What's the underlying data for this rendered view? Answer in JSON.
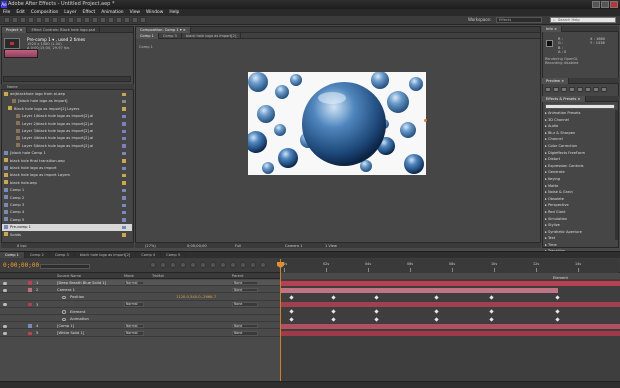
{
  "window": {
    "title": "Adobe After Effects - Untitled Project.aep *",
    "app_icon": "Ae"
  },
  "menu": [
    "File",
    "Edit",
    "Composition",
    "Layer",
    "Effect",
    "Animation",
    "View",
    "Window",
    "Help"
  ],
  "toolbar": {
    "workspace_label": "Workspace:",
    "workspace_value": "Effects",
    "search_placeholder": "Search Help"
  },
  "project": {
    "tabs": [
      "Project ×",
      "Effect Controls: Black hole logo.psd"
    ],
    "selected_comp": "Pre-comp 1 ▾ , used 2 times",
    "comp_info": "1920 x 1080 (1.00)\nΔ 0;00;15;00, 29.97 fps",
    "column_header": "Name",
    "items": [
      {
        "label": "ae(blackhole logo from ai.aep",
        "type": "folder",
        "indent": 0,
        "color": "#c9a94a"
      },
      {
        "label": "[black hole logo as import]",
        "type": "layer",
        "indent": 2,
        "color": "#888888"
      },
      {
        "label": "Black hole logo as import[2] Layers",
        "type": "folder",
        "indent": 1,
        "color": "#c9a94a"
      },
      {
        "label": "Layer 1/black hole logo as import[2].ai",
        "type": "layer",
        "indent": 3,
        "color": "#7f7fbf"
      },
      {
        "label": "Layer 2/black hole logo as import[2].ai",
        "type": "layer",
        "indent": 3,
        "color": "#7f7fbf"
      },
      {
        "label": "Layer 3/black hole logo as import[2].ai",
        "type": "layer",
        "indent": 3,
        "color": "#7f7fbf"
      },
      {
        "label": "Layer 4/black hole logo as import[2].ai",
        "type": "layer",
        "indent": 3,
        "color": "#7f7fbf"
      },
      {
        "label": "Layer 5/black hole logo as import[2].ai",
        "type": "layer",
        "indent": 3,
        "color": "#7f7fbf"
      },
      {
        "label": "[black hole Comp 1",
        "type": "comp",
        "indent": 0,
        "color": "#7a8ab5"
      },
      {
        "label": "black hole final transition.aep",
        "type": "folder",
        "indent": 0,
        "color": "#c9a94a"
      },
      {
        "label": "black hole logo as import",
        "type": "comp",
        "indent": 0,
        "color": "#7a8ab5"
      },
      {
        "label": "black hole logo as import Layers",
        "type": "folder",
        "indent": 0,
        "color": "#c9a94a"
      },
      {
        "label": "black hole.aep",
        "type": "folder",
        "indent": 0,
        "color": "#c9a94a"
      },
      {
        "label": "Comp 1",
        "type": "comp",
        "indent": 0,
        "color": "#7a8ab5"
      },
      {
        "label": "Comp 2",
        "type": "comp",
        "indent": 0,
        "color": "#7a8ab5"
      },
      {
        "label": "Comp 3",
        "type": "comp",
        "indent": 0,
        "color": "#7a8ab5"
      },
      {
        "label": "Comp 4",
        "type": "comp",
        "indent": 0,
        "color": "#7a8ab5"
      },
      {
        "label": "Comp 5",
        "type": "comp",
        "indent": 0,
        "color": "#7a8ab5"
      },
      {
        "label": "Pre-comp 1",
        "type": "comp",
        "indent": 0,
        "color": "#7a8ab5",
        "selected": true
      },
      {
        "label": "Solids",
        "type": "folder",
        "indent": 0,
        "color": "#c9a94a"
      }
    ],
    "footer": "8 bpc"
  },
  "composition": {
    "tabs": [
      "Composition: Comp 1 ▾ ×"
    ],
    "subtabs": [
      "Comp 1",
      "Comp 3",
      "black hole logo as import[2]"
    ],
    "crumb": "Comp 1",
    "footer": {
      "zoom": "(27%)",
      "timecode": "0;00;00;00",
      "resolution": "Full",
      "camera": "Camera 1",
      "views": "1 View"
    }
  },
  "info_panel": {
    "tab": "Info ×",
    "rgba": "R :\nG :\nB :\nA : 0",
    "xy": "X : 1680\nY : 1536",
    "note": "Rendering OpenGL\nRecording disabled"
  },
  "preview": {
    "tab": "Preview ×"
  },
  "effects": {
    "tab": "Effects & Presets ×",
    "items": [
      {
        "label": "▸ Animation Presets"
      },
      {
        "label": "▸ 3D Channel"
      },
      {
        "label": "▸ Audio"
      },
      {
        "label": "▸ Blur & Sharpen"
      },
      {
        "label": "▸ Channel"
      },
      {
        "label": "▸ Color Correction"
      },
      {
        "label": "▸ Digieffects FreeForm"
      },
      {
        "label": "▸ Distort"
      },
      {
        "label": "▸ Expression Controls"
      },
      {
        "label": "▸ Generate"
      },
      {
        "label": "▸ Keying"
      },
      {
        "label": "▸ Matte"
      },
      {
        "label": "▸ Noise & Grain"
      },
      {
        "label": "▸ Obsolete"
      },
      {
        "label": "▸ Perspective"
      },
      {
        "label": "▸ Red Giant"
      },
      {
        "label": "▸ Simulation"
      },
      {
        "label": "▸ Stylize"
      },
      {
        "label": "▸ Synthetic Aperture"
      },
      {
        "label": "▸ Text"
      },
      {
        "label": "▸ Time"
      },
      {
        "label": "▸ Transition"
      },
      {
        "label": "▸ Trapcode"
      },
      {
        "label": "▸ Utility"
      },
      {
        "label": "▾ Video Copilot"
      },
      {
        "label": "Element",
        "sub": true
      },
      {
        "label": "Optical Flares",
        "sub": true,
        "selected": true
      }
    ]
  },
  "timeline": {
    "tabs": [
      "Comp 1",
      "Comp 2",
      "Comp 3",
      "black hole logo as import[2]",
      "Comp 4",
      "Comp 5"
    ],
    "timecode": "0;00;00;00",
    "ruler": [
      "00s",
      "02s",
      "04s",
      "06s",
      "08s",
      "10s",
      "12s",
      "14s"
    ],
    "columns": {
      "source": "Source Name",
      "mode": "Mode",
      "trkmat": "TrkMat",
      "parent": "Parent"
    },
    "layers": [
      {
        "num": "1",
        "name": "[Deep Breath Blue Solid 1]",
        "swatch": "#c04050",
        "mode": "Normal",
        "parent": "None",
        "bar": "#b84050",
        "hl": true
      },
      {
        "num": "2",
        "name": "Camera 1",
        "swatch": "#c07080",
        "mode": "",
        "parent": "None",
        "bar": "#c07585"
      },
      {
        "num": "",
        "name": "Position",
        "value": "1120.0,540.0,-2666.7",
        "prop": true
      },
      {
        "num": "3",
        "name": "",
        "swatch": "#b04050",
        "mode": "Normal",
        "parent": "None",
        "bar": "#a04050"
      },
      {
        "num": "",
        "name": "Element",
        "prop": true
      },
      {
        "num": "",
        "name": "Animation",
        "value": "",
        "prop": true
      },
      {
        "num": "4",
        "name": "[Comp 1]",
        "swatch": "#7a8ab5",
        "mode": "Normal",
        "parent": "None",
        "bar": "#b05060"
      },
      {
        "num": "5",
        "name": "[White Solid 1]",
        "swatch": "#c04050",
        "mode": "Normal",
        "parent": "None",
        "bar": "#a03a48"
      }
    ]
  }
}
